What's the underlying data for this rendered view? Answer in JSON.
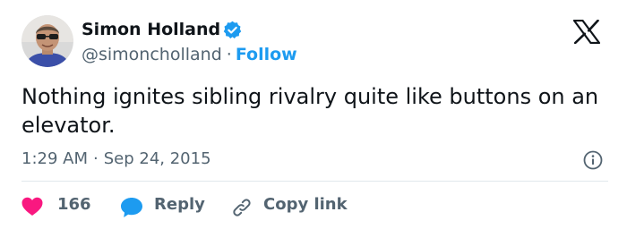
{
  "user": {
    "display_name": "Simon Holland",
    "handle": "@simoncholland",
    "separator": "·",
    "follow_label": "Follow"
  },
  "tweet": {
    "text": "Nothing ignites sibling rivalry quite like buttons on an elevator.",
    "time": "1:29 AM",
    "separator": "·",
    "date": "Sep 24, 2015"
  },
  "actions": {
    "like_count": "166",
    "reply_label": "Reply",
    "copy_link_label": "Copy link"
  },
  "icons": {
    "verified": "verified-badge-icon",
    "logo": "x-logo-icon",
    "info": "info-icon",
    "like": "heart-icon",
    "reply": "speech-bubble-icon",
    "copy": "link-icon"
  },
  "colors": {
    "accent": "#1d9bf0",
    "like": "#f91880",
    "text": "#0f1419",
    "muted": "#536471",
    "divider": "#e1e8ed"
  }
}
